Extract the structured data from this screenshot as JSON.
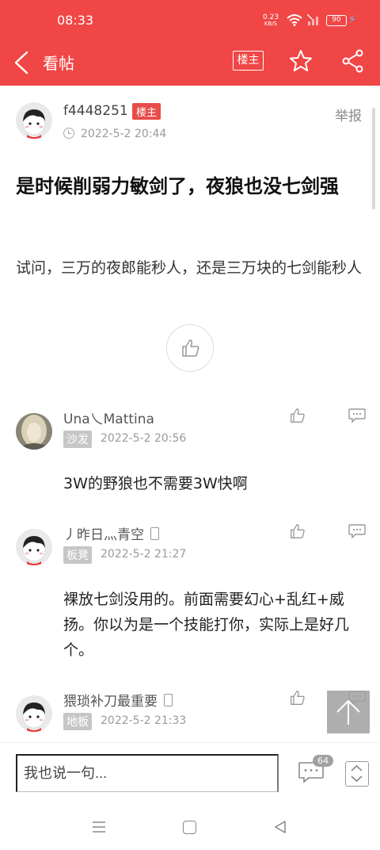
{
  "status_bar": {
    "time": "08:33",
    "net_speed_value": "0.23",
    "net_speed_unit": "KB/S",
    "battery": "90"
  },
  "app_bar": {
    "title": "看帖",
    "op_only_label": "楼主"
  },
  "post": {
    "author": "f4448251",
    "author_badge": "楼主",
    "time": "2022-5-2 20:44",
    "report_label": "举报",
    "title": "是时候削弱力敏剑了，夜狼也没七剑强",
    "body": "试问，三万的夜郎能秒人，还是三万块的七剑能秒人"
  },
  "replies": [
    {
      "author": "Una乀Mattina",
      "floor": "沙发",
      "time": "2022-5-2 20:56",
      "body": "3W的野狼也不需要3W快啊"
    },
    {
      "author": "丿昨日灬青空",
      "floor": "板凳",
      "time": "2022-5-2 21:27",
      "body": "裸放七剑没用的。前面需要幻心+乱红+威扬。你以为是一个技能打你，实际上是好几个。"
    },
    {
      "author": "猥琐补刀最重要",
      "floor": "地板",
      "time": "2022-5-2 21:33",
      "body": ""
    }
  ],
  "bottom_bar": {
    "reply_placeholder": "我也说一句...",
    "comment_count": "64"
  },
  "colors": {
    "brand": "#f14646",
    "op_badge": "#e94b4b",
    "floor_badge": "#c6c6c6"
  }
}
